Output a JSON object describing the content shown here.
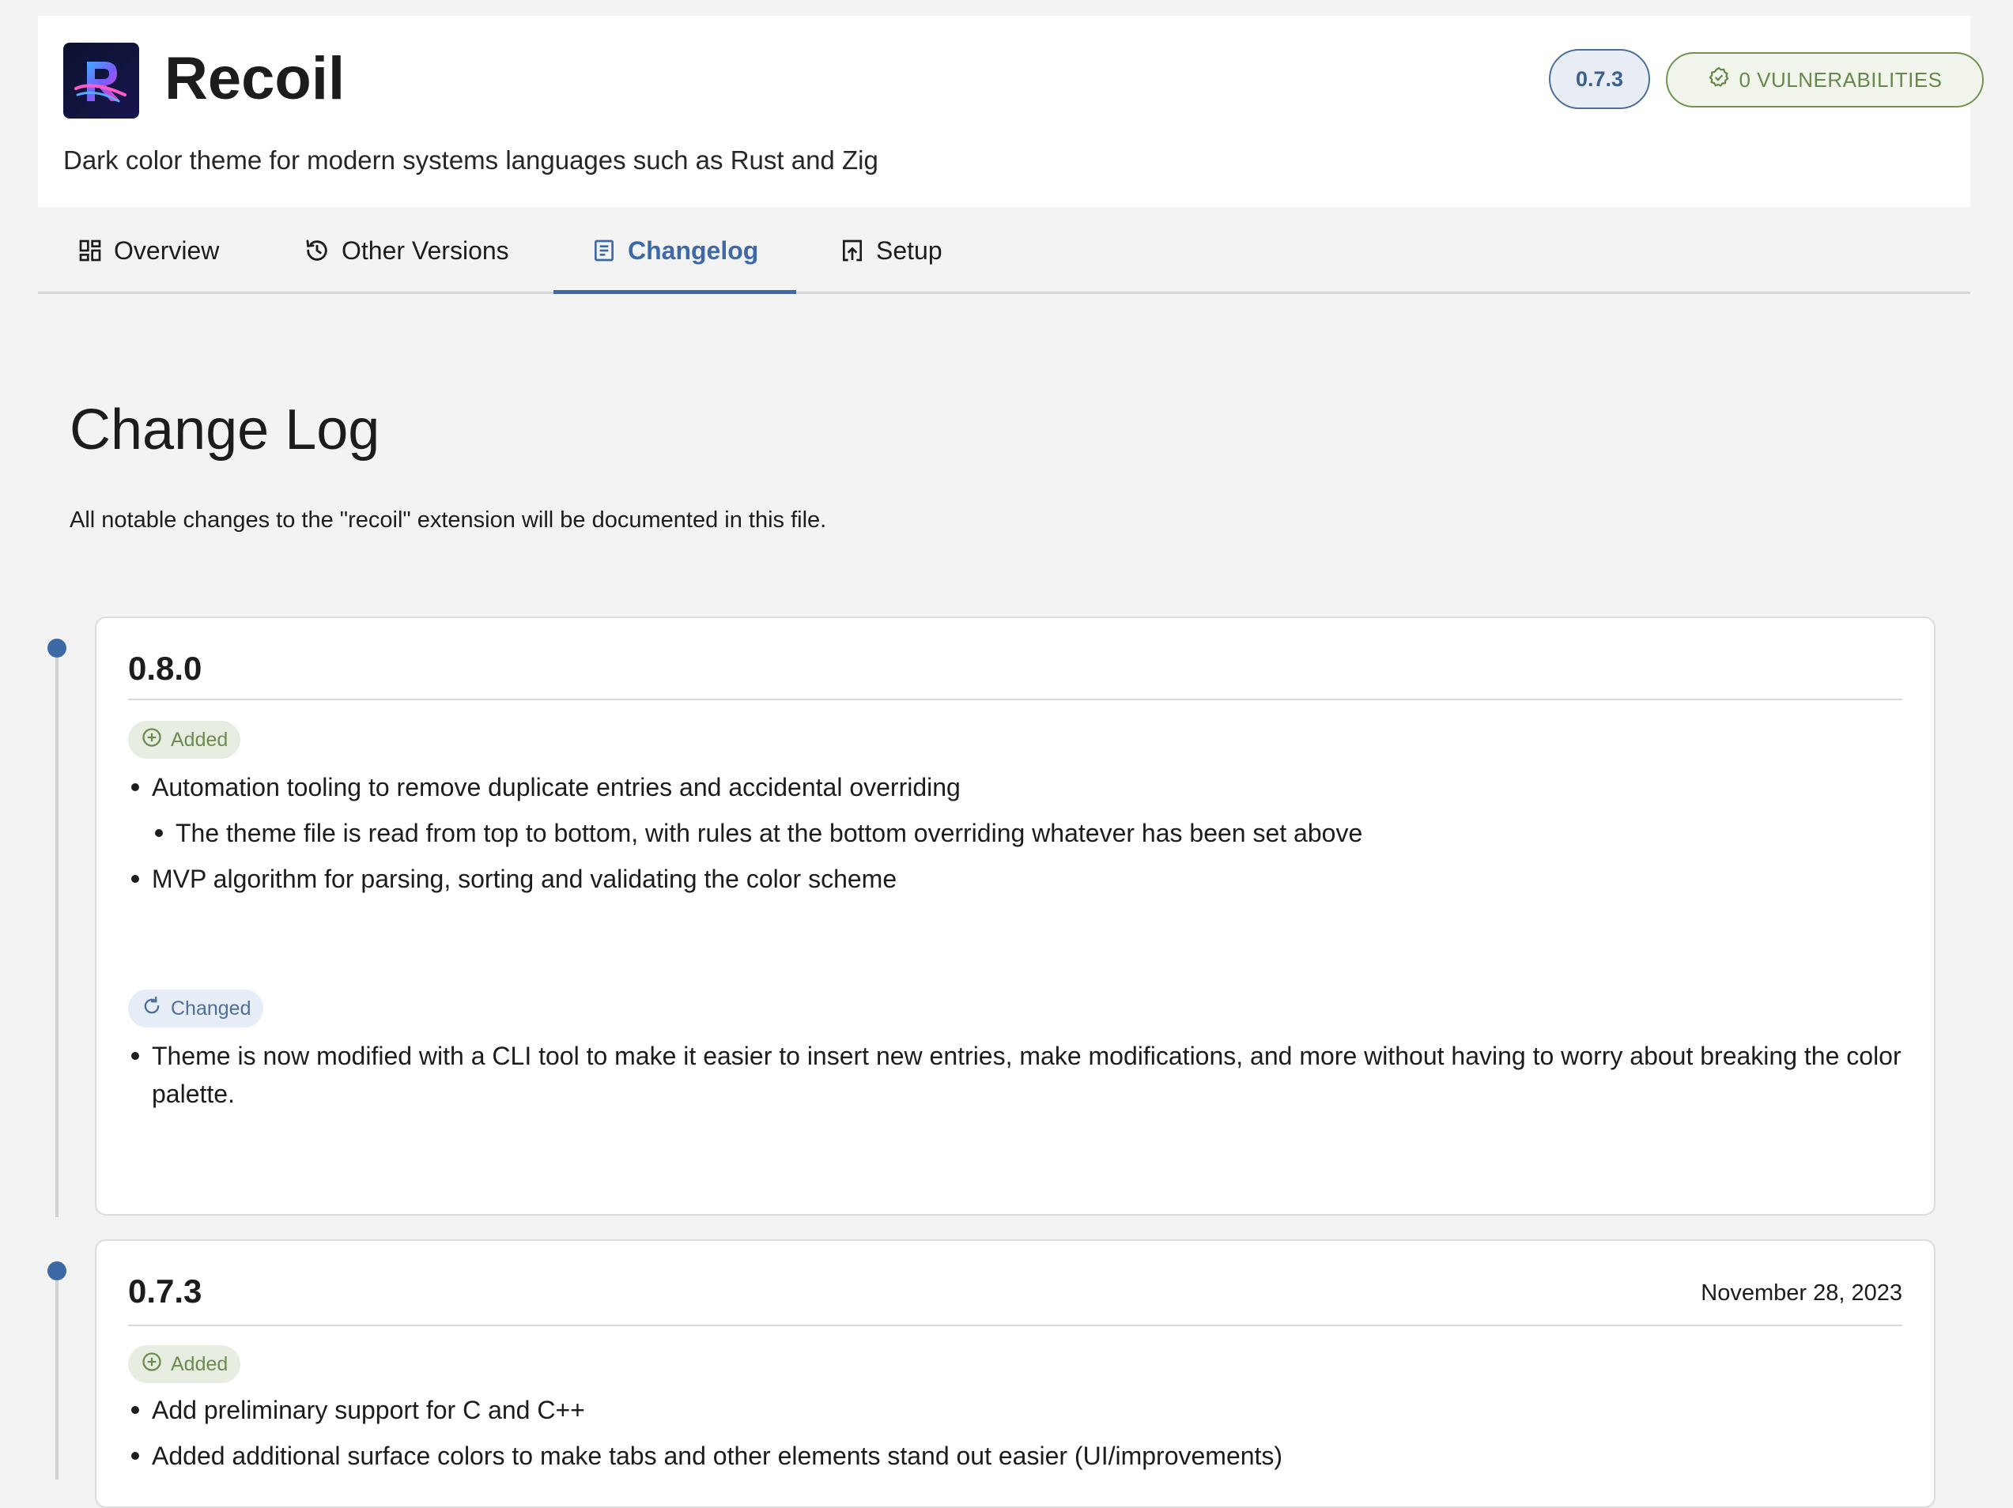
{
  "header": {
    "title": "Recoil",
    "description": "Dark color theme for modern systems languages such as Rust and Zig",
    "version_badge": "0.7.3",
    "vulnerabilities_badge": "0 VULNERABILITIES"
  },
  "tabs": [
    {
      "label": "Overview",
      "icon": "grid-icon"
    },
    {
      "label": "Other Versions",
      "icon": "history-icon"
    },
    {
      "label": "Changelog",
      "icon": "document-icon",
      "active": true
    },
    {
      "label": "Setup",
      "icon": "upload-box-icon"
    }
  ],
  "changelog": {
    "title": "Change Log",
    "intro": "All notable changes to the \"recoil\" extension will be documented in this file.",
    "entries": [
      {
        "version": "0.8.0",
        "date": "",
        "sections": [
          {
            "type": "Added",
            "items": [
              "Automation tooling to remove duplicate entries and accidental overriding",
              "The theme file is read from top to bottom, with rules at the bottom overriding whatever has been set above",
              "MVP algorithm for parsing, sorting and validating the color scheme"
            ]
          },
          {
            "type": "Changed",
            "items": [
              "Theme is now modified with a CLI tool to make it easier to insert new entries, make modifications, and more without having to worry about breaking the color palette."
            ]
          }
        ]
      },
      {
        "version": "0.7.3",
        "date": "November 28, 2023",
        "sections": [
          {
            "type": "Added",
            "items": [
              "Add preliminary support for C and C++",
              "Added additional surface colors to make tabs and other elements stand out easier (UI/improvements)"
            ]
          }
        ]
      }
    ]
  },
  "colors": {
    "accent": "#3d6aa7",
    "added": "#6b8b4f",
    "changed": "#4d6f9a"
  }
}
